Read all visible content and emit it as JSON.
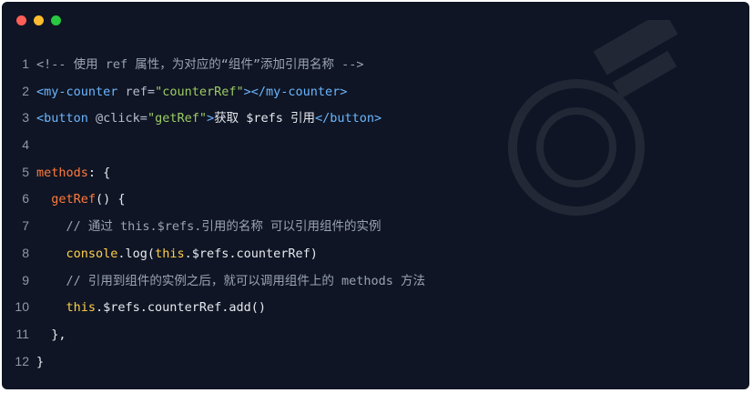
{
  "window": {
    "controls": [
      "close",
      "minimize",
      "maximize"
    ],
    "colors": {
      "close": "#fe5f57",
      "minimize": "#febc2e",
      "maximize": "#28c840",
      "background": "#0f1524"
    }
  },
  "code": {
    "lines": [
      {
        "num": "1",
        "tokens": [
          {
            "t": "<!-- 使用 ref 属性，为对应的“组件”添加引用名称 -->",
            "c": "comment"
          }
        ]
      },
      {
        "num": "2",
        "tokens": [
          {
            "t": "<my-counter ",
            "c": "tag"
          },
          {
            "t": "ref=",
            "c": "attr"
          },
          {
            "t": "\"counterRef\"",
            "c": "string"
          },
          {
            "t": "></my-counter>",
            "c": "tag"
          }
        ]
      },
      {
        "num": "3",
        "tokens": [
          {
            "t": "<button ",
            "c": "tag"
          },
          {
            "t": "@click=",
            "c": "attr"
          },
          {
            "t": "\"getRef\"",
            "c": "string"
          },
          {
            "t": ">",
            "c": "tag"
          },
          {
            "t": "获取 $refs 引用",
            "c": "text"
          },
          {
            "t": "</button>",
            "c": "tag"
          }
        ]
      },
      {
        "num": "4",
        "tokens": []
      },
      {
        "num": "5",
        "tokens": [
          {
            "t": "methods",
            "c": "key"
          },
          {
            "t": ": {",
            "c": "punc"
          }
        ]
      },
      {
        "num": "6",
        "tokens": [
          {
            "t": "  ",
            "c": "punc"
          },
          {
            "t": "getRef",
            "c": "fn"
          },
          {
            "t": "() {",
            "c": "punc"
          }
        ]
      },
      {
        "num": "7",
        "tokens": [
          {
            "t": "    // 通过 this.$refs.引用的名称 可以引用组件的实例",
            "c": "comment"
          }
        ]
      },
      {
        "num": "8",
        "tokens": [
          {
            "t": "    ",
            "c": "punc"
          },
          {
            "t": "console",
            "c": "obj"
          },
          {
            "t": ".log(",
            "c": "punc"
          },
          {
            "t": "this",
            "c": "this"
          },
          {
            "t": ".$refs.counterRef)",
            "c": "punc"
          }
        ]
      },
      {
        "num": "9",
        "tokens": [
          {
            "t": "    // 引用到组件的实例之后，就可以调用组件上的 methods 方法",
            "c": "comment"
          }
        ]
      },
      {
        "num": "10",
        "tokens": [
          {
            "t": "    ",
            "c": "punc"
          },
          {
            "t": "this",
            "c": "this"
          },
          {
            "t": ".$refs.counterRef.add()",
            "c": "punc"
          }
        ]
      },
      {
        "num": "11",
        "tokens": [
          {
            "t": "  },",
            "c": "punc"
          }
        ]
      },
      {
        "num": "12",
        "tokens": [
          {
            "t": "}",
            "c": "punc"
          }
        ]
      }
    ]
  }
}
